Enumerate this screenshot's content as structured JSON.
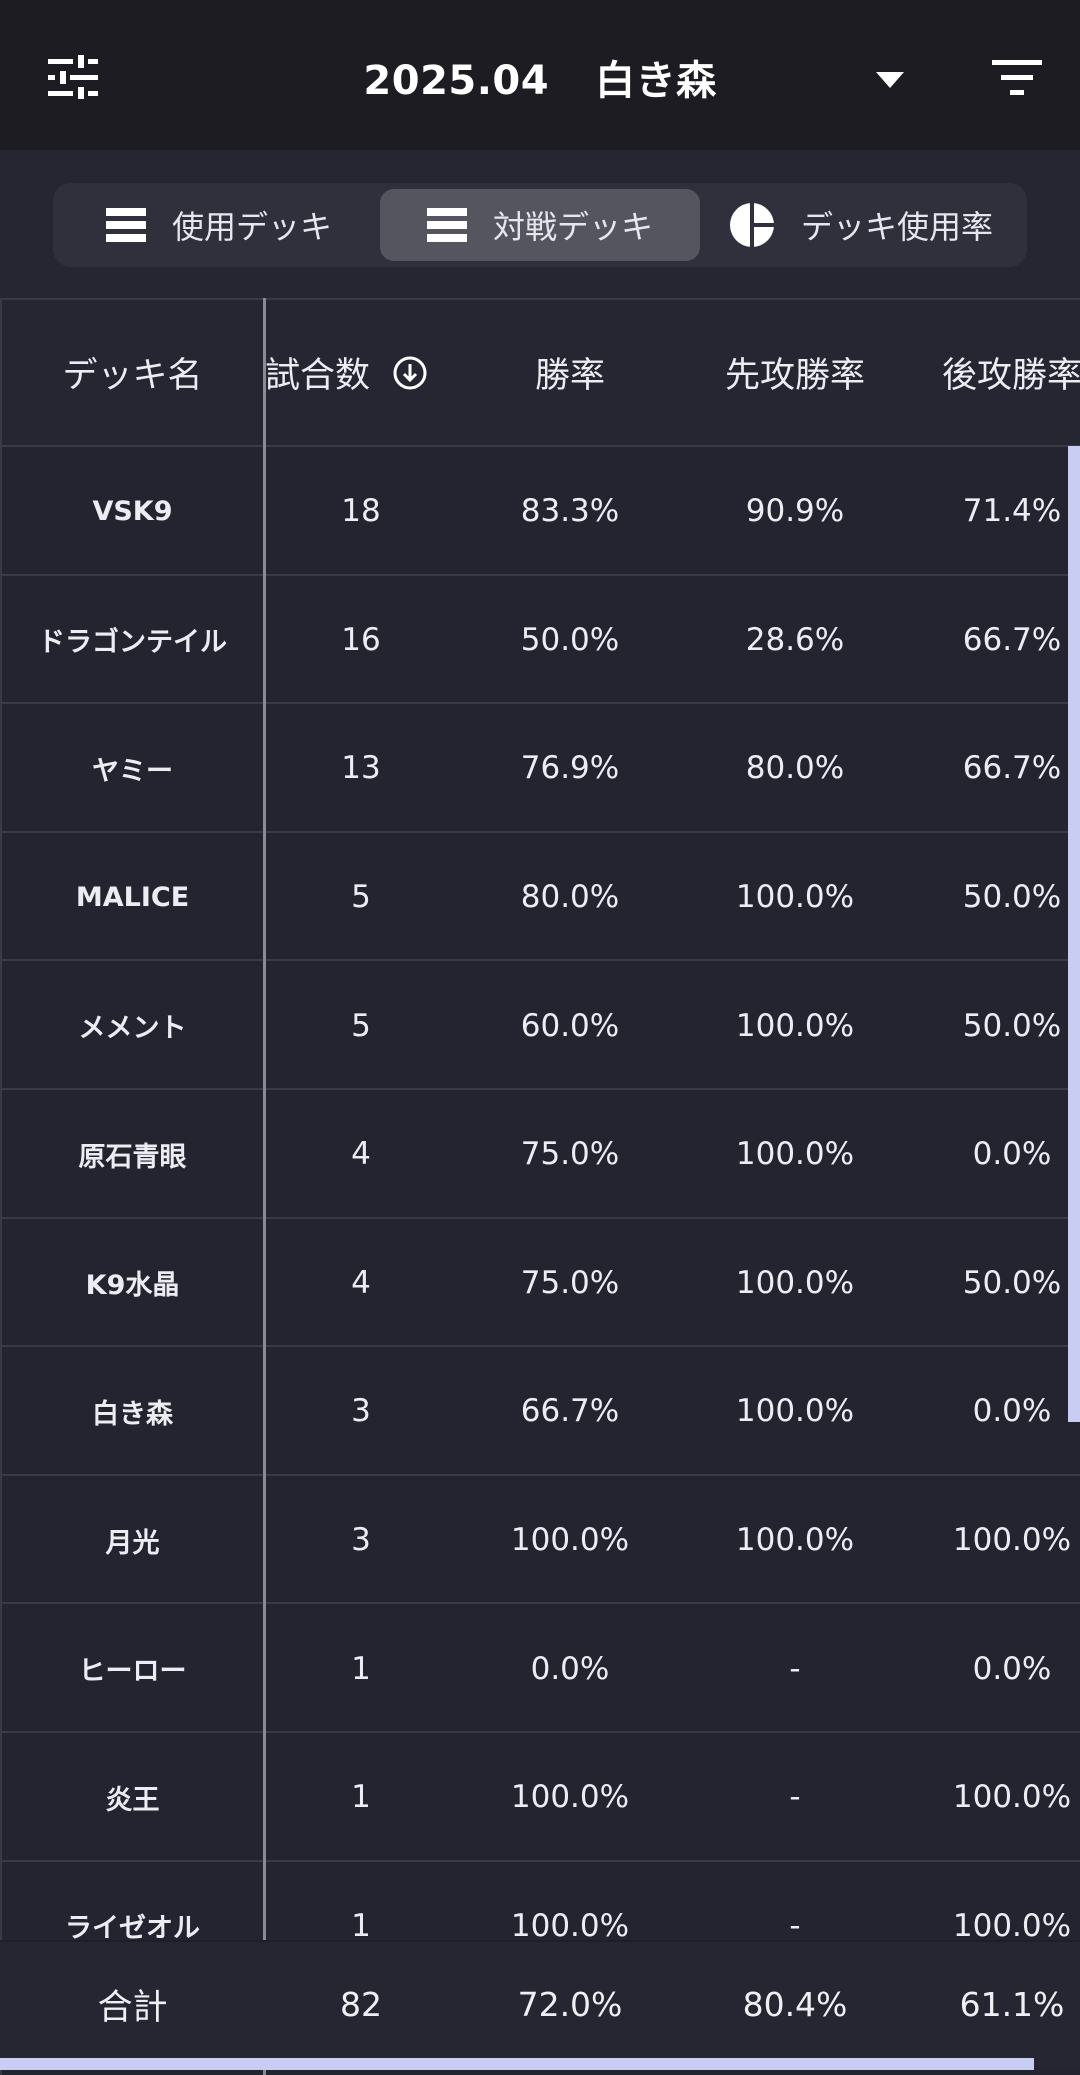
{
  "header": {
    "month": "2025.04",
    "deck": "白き森",
    "icons": {
      "left": "tune-sliders-icon",
      "dropdown": "caret-down-icon",
      "right": "filter-icon"
    }
  },
  "tabs": [
    {
      "label": "使用デッキ",
      "icon": "list-icon",
      "active": false
    },
    {
      "label": "対戦デッキ",
      "icon": "list-icon",
      "active": true
    },
    {
      "label": "デッキ使用率",
      "icon": "pie-chart-icon",
      "active": false
    }
  ],
  "table": {
    "columns": [
      "デッキ名",
      "試合数",
      "勝率",
      "先攻勝率",
      "後攻勝率"
    ],
    "sort_icon": "sort-desc-circle-icon",
    "rows": [
      {
        "name": "VSK9",
        "games": "18",
        "win": "83.3%",
        "first": "90.9%",
        "second": "71.4%"
      },
      {
        "name": "ドラゴンテイル",
        "games": "16",
        "win": "50.0%",
        "first": "28.6%",
        "second": "66.7%"
      },
      {
        "name": "ヤミー",
        "games": "13",
        "win": "76.9%",
        "first": "80.0%",
        "second": "66.7%"
      },
      {
        "name": "MALICE",
        "games": "5",
        "win": "80.0%",
        "first": "100.0%",
        "second": "50.0%"
      },
      {
        "name": "メメント",
        "games": "5",
        "win": "60.0%",
        "first": "100.0%",
        "second": "50.0%"
      },
      {
        "name": "原石青眼",
        "games": "4",
        "win": "75.0%",
        "first": "100.0%",
        "second": "0.0%"
      },
      {
        "name": "K9水晶",
        "games": "4",
        "win": "75.0%",
        "first": "100.0%",
        "second": "50.0%"
      },
      {
        "name": "白き森",
        "games": "3",
        "win": "66.7%",
        "first": "100.0%",
        "second": "0.0%"
      },
      {
        "name": "月光",
        "games": "3",
        "win": "100.0%",
        "first": "100.0%",
        "second": "100.0%"
      },
      {
        "name": "ヒーロー",
        "games": "1",
        "win": "0.0%",
        "first": "-",
        "second": "0.0%"
      },
      {
        "name": "炎王",
        "games": "1",
        "win": "100.0%",
        "first": "-",
        "second": "100.0%"
      },
      {
        "name": "ライゼオル",
        "games": "1",
        "win": "100.0%",
        "first": "-",
        "second": "100.0%"
      }
    ],
    "total": {
      "name": "合計",
      "games": "82",
      "win": "72.0%",
      "first": "80.4%",
      "second": "61.1%"
    }
  },
  "colors": {
    "appbar": "#1c1c22",
    "background": "#242430",
    "active_tab": "#55555f",
    "scrollbar": "#c9cdf4"
  }
}
